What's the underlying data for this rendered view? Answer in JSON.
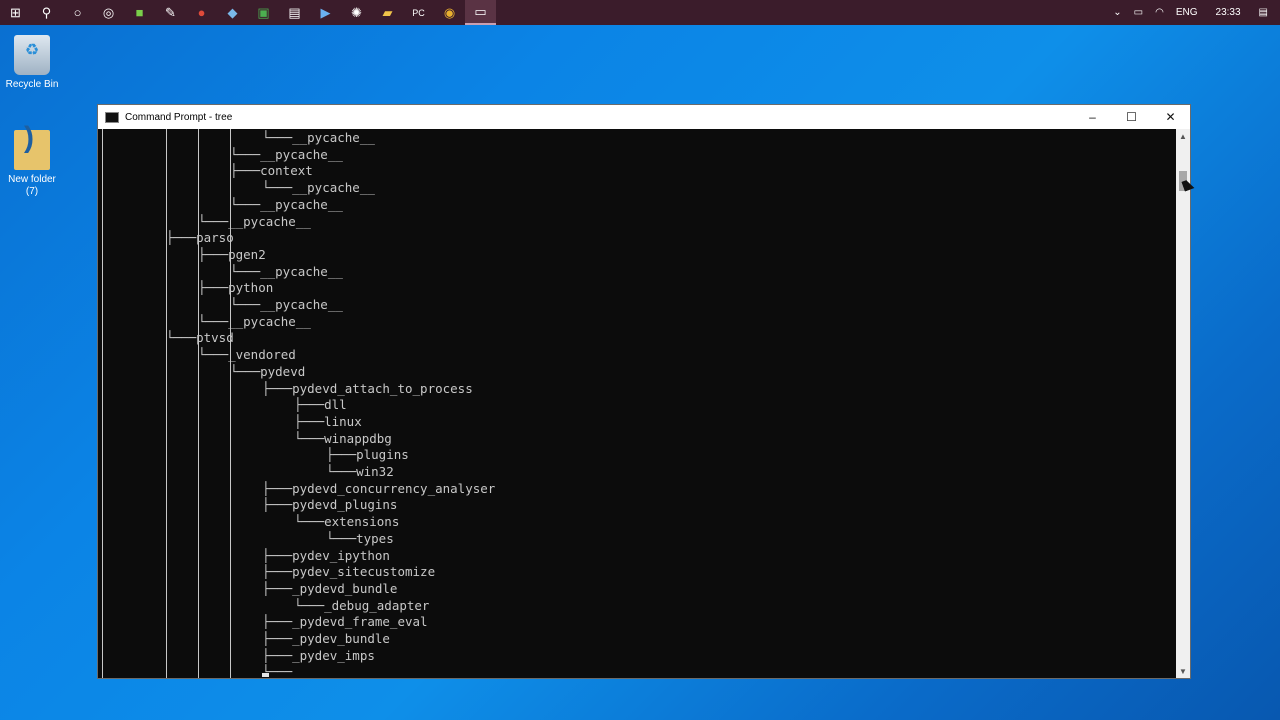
{
  "taskbar": {
    "icons": [
      "windows-start-icon",
      "search-icon",
      "cortana-icon",
      "task-view-icon",
      "app-icon",
      "pen-icon",
      "app-icon",
      "steam-icon",
      "app-icon",
      "store-icon",
      "app-icon",
      "app-icon",
      "folder-icon",
      "pycharm-icon",
      "chrome-icon",
      "command-prompt-icon"
    ],
    "tray": {
      "language": "ENG",
      "time": "23:33"
    }
  },
  "desktop": {
    "recycle_bin": "Recycle Bin",
    "new_folder": "New folder",
    "new_folder_sub": "(7)"
  },
  "window": {
    "title": "Command Prompt - tree",
    "minimize": "–",
    "maximize": "☐",
    "close": "✕"
  },
  "console": {
    "lines": [
      {
        "col": 20,
        "text": "└───__pycache__"
      },
      {
        "col": 16,
        "text": "└───__pycache__"
      },
      {
        "col": 16,
        "text": "├───context"
      },
      {
        "col": 20,
        "text": "└───__pycache__"
      },
      {
        "col": 16,
        "text": "└───__pycache__"
      },
      {
        "col": 12,
        "text": "└───__pycache__"
      },
      {
        "col": 8,
        "text": "├───parso"
      },
      {
        "col": 12,
        "text": "├───pgen2"
      },
      {
        "col": 16,
        "text": "└───__pycache__"
      },
      {
        "col": 12,
        "text": "├───python"
      },
      {
        "col": 16,
        "text": "└───__pycache__"
      },
      {
        "col": 12,
        "text": "└───__pycache__"
      },
      {
        "col": 8,
        "text": "└───ptvsd"
      },
      {
        "col": 12,
        "text": "└───_vendored"
      },
      {
        "col": 16,
        "text": "└───pydevd"
      },
      {
        "col": 20,
        "text": "├───pydevd_attach_to_process"
      },
      {
        "col": 24,
        "text": "├───dll"
      },
      {
        "col": 24,
        "text": "├───linux"
      },
      {
        "col": 24,
        "text": "└───winappdbg"
      },
      {
        "col": 28,
        "text": "├───plugins"
      },
      {
        "col": 28,
        "text": "└───win32"
      },
      {
        "col": 20,
        "text": "├───pydevd_concurrency_analyser"
      },
      {
        "col": 20,
        "text": "├───pydevd_plugins"
      },
      {
        "col": 24,
        "text": "└───extensions"
      },
      {
        "col": 28,
        "text": "└───types"
      },
      {
        "col": 20,
        "text": "├───pydev_ipython"
      },
      {
        "col": 20,
        "text": "├───pydev_sitecustomize"
      },
      {
        "col": 20,
        "text": "├───_pydevd_bundle"
      },
      {
        "col": 24,
        "text": "└───_debug_adapter"
      },
      {
        "col": 20,
        "text": "├───_pydevd_frame_eval"
      },
      {
        "col": 20,
        "text": "├───_pydev_bundle"
      },
      {
        "col": 20,
        "text": "├───_pydev_imps"
      },
      {
        "col": 20,
        "text": "└───"
      }
    ]
  }
}
